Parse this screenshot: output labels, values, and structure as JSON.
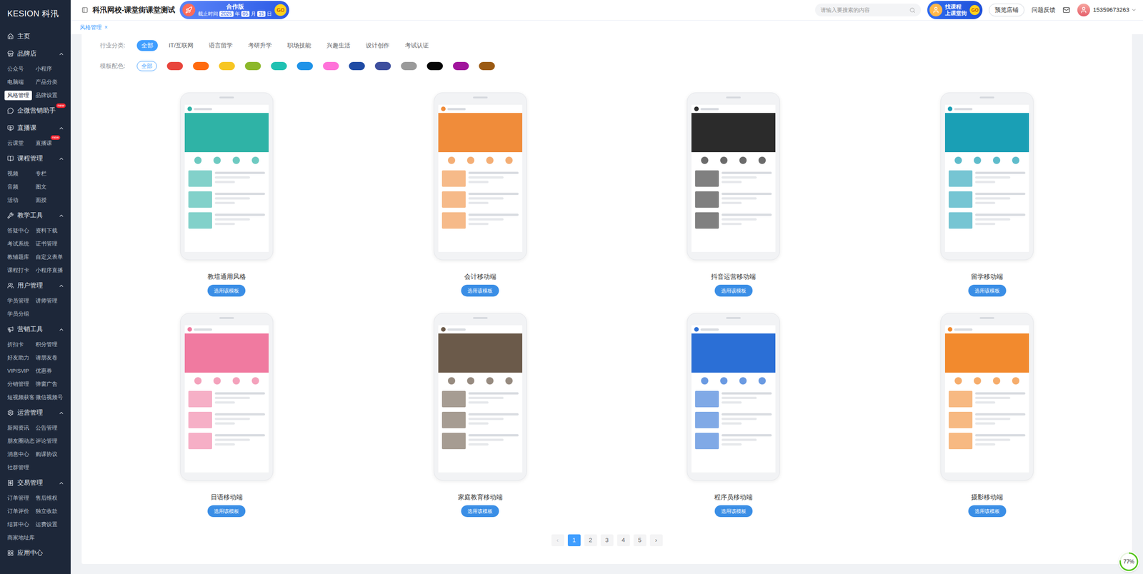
{
  "sidebar": {
    "logo": "KESION 科汛",
    "groups": [
      {
        "label": "主页",
        "kind": "link",
        "items": []
      },
      {
        "label": "品牌店",
        "kind": "group",
        "expanded": true,
        "items": [
          {
            "label": "公众号",
            "selected": false
          },
          {
            "label": "小程序",
            "selected": false
          },
          {
            "label": "电脑端",
            "selected": false
          },
          {
            "label": "产品分类",
            "selected": false
          },
          {
            "label": "风格管理",
            "selected": true
          },
          {
            "label": "品牌设置",
            "selected": false
          }
        ]
      },
      {
        "label": "企微营销助手",
        "kind": "link",
        "badge": "new",
        "items": []
      },
      {
        "label": "直播课",
        "kind": "group",
        "expanded": true,
        "items": [
          {
            "label": "云课堂",
            "selected": false
          },
          {
            "label": "直播课",
            "selected": false,
            "badge": "new"
          }
        ]
      },
      {
        "label": "课程管理",
        "kind": "group",
        "expanded": true,
        "items": [
          {
            "label": "视频",
            "selected": false
          },
          {
            "label": "专栏",
            "selected": false
          },
          {
            "label": "音频",
            "selected": false
          },
          {
            "label": "图文",
            "selected": false
          },
          {
            "label": "活动",
            "selected": false
          },
          {
            "label": "面授",
            "selected": false
          }
        ]
      },
      {
        "label": "教学工具",
        "kind": "group",
        "expanded": true,
        "items": [
          {
            "label": "答疑中心",
            "selected": false
          },
          {
            "label": "资料下载",
            "selected": false
          },
          {
            "label": "考试系统",
            "selected": false
          },
          {
            "label": "证书管理",
            "selected": false
          },
          {
            "label": "教辅题库",
            "selected": false
          },
          {
            "label": "自定义表单",
            "selected": false
          },
          {
            "label": "课程打卡",
            "selected": false
          },
          {
            "label": "小程序直播",
            "selected": false
          }
        ]
      },
      {
        "label": "用户管理",
        "kind": "group",
        "expanded": true,
        "items": [
          {
            "label": "学员管理",
            "selected": false
          },
          {
            "label": "讲师管理",
            "selected": false
          },
          {
            "label": "学员分组",
            "selected": false
          }
        ]
      },
      {
        "label": "营销工具",
        "kind": "group",
        "expanded": true,
        "items": [
          {
            "label": "折扣卡",
            "selected": false
          },
          {
            "label": "积分管理",
            "selected": false
          },
          {
            "label": "好友助力",
            "selected": false
          },
          {
            "label": "请朋友卷",
            "selected": false
          },
          {
            "label": "VIP/SVIP",
            "selected": false
          },
          {
            "label": "优惠券",
            "selected": false
          },
          {
            "label": "分销管理",
            "selected": false
          },
          {
            "label": "弹窗广告",
            "selected": false
          },
          {
            "label": "短视频获客",
            "selected": false
          },
          {
            "label": "微信视频号",
            "selected": false
          }
        ]
      },
      {
        "label": "运营管理",
        "kind": "group",
        "expanded": true,
        "items": [
          {
            "label": "新闻资讯",
            "selected": false
          },
          {
            "label": "公告管理",
            "selected": false
          },
          {
            "label": "朋友圈动态",
            "selected": false
          },
          {
            "label": "评论管理",
            "selected": false
          },
          {
            "label": "消息中心",
            "selected": false
          },
          {
            "label": "购课协议",
            "selected": false
          },
          {
            "label": "社群管理",
            "selected": false
          }
        ]
      },
      {
        "label": "交易管理",
        "kind": "group",
        "expanded": true,
        "items": [
          {
            "label": "订单管理",
            "selected": false
          },
          {
            "label": "售后维权",
            "selected": false
          },
          {
            "label": "订单评价",
            "selected": false
          },
          {
            "label": "独立收款",
            "selected": false
          },
          {
            "label": "结算中心",
            "selected": false
          },
          {
            "label": "运费设置",
            "selected": false
          },
          {
            "label": "商家地址库",
            "selected": false
          }
        ]
      }
    ],
    "footer": "应用中心"
  },
  "header": {
    "title": "科汛网校-课堂街课堂测试",
    "edition_banner": {
      "title": "合作版",
      "deadline": [
        {
          "text": "截止时间",
          "kind": "label"
        },
        {
          "text": "2025",
          "kind": "value"
        },
        {
          "text": "年",
          "kind": "label"
        },
        {
          "text": "05",
          "kind": "value"
        },
        {
          "text": "月",
          "kind": "label"
        },
        {
          "text": "15",
          "kind": "value"
        },
        {
          "text": "日",
          "kind": "label"
        }
      ],
      "go": "GO"
    },
    "search": {
      "placeholder": "请输入要搜索的内容"
    },
    "promo": {
      "lines": [
        "找课程",
        "上课堂街"
      ],
      "go": "GO"
    },
    "preview_button": "预览店铺",
    "feedback": "问题反馈",
    "user": "15359673263"
  },
  "tabs": [
    {
      "label": "风格管理",
      "selected": true,
      "close": "×"
    }
  ],
  "filters": {
    "industry": {
      "label": "行业分类:",
      "options": [
        {
          "label": "全部",
          "selected": true
        },
        {
          "label": "IT/互联网",
          "selected": false
        },
        {
          "label": "语言留学",
          "selected": false
        },
        {
          "label": "考研升学",
          "selected": false
        },
        {
          "label": "职场技能",
          "selected": false
        },
        {
          "label": "兴趣生活",
          "selected": false
        },
        {
          "label": "设计创作",
          "selected": false
        },
        {
          "label": "考试认证",
          "selected": false
        }
      ]
    },
    "palette": {
      "label": "模板配色:",
      "all": {
        "label": "全部",
        "selected": true
      },
      "colors": [
        {
          "color": "#e8453c",
          "selected": false
        },
        {
          "color": "#ff6a0e",
          "selected": false
        },
        {
          "color": "#f7c623",
          "selected": false
        },
        {
          "color": "#8cb82b",
          "selected": false
        },
        {
          "color": "#1fc1b2",
          "selected": false
        },
        {
          "color": "#1f93e8",
          "selected": false
        },
        {
          "color": "#ff72d9",
          "selected": false
        },
        {
          "color": "#1f4ba5",
          "selected": false
        },
        {
          "color": "#3e4f9e",
          "selected": false
        },
        {
          "color": "#9a9a9a",
          "selected": false
        },
        {
          "color": "#050505",
          "selected": false
        },
        {
          "color": "#a0149c",
          "selected": false
        },
        {
          "color": "#9b5a13",
          "selected": false
        }
      ]
    }
  },
  "templates": [
    {
      "name": "教培通用风格",
      "action": "选用该模板",
      "color": "#2fb3a6"
    },
    {
      "name": "会计移动端",
      "action": "选用该模板",
      "color": "#f08c3a"
    },
    {
      "name": "抖音运营移动端",
      "action": "选用该模板",
      "color": "#2b2b2b"
    },
    {
      "name": "留学移动端",
      "action": "选用该模板",
      "color": "#1a9fb5"
    },
    {
      "name": "日语移动端",
      "action": "选用该模板",
      "color": "#f07aa0"
    },
    {
      "name": "家庭教育移动端",
      "action": "选用该模板",
      "color": "#6b5a4a"
    },
    {
      "name": "程序员移动端",
      "action": "选用该模板",
      "color": "#2b6fd6"
    },
    {
      "name": "摄影移动端",
      "action": "选用该模板",
      "color": "#f28a2e"
    }
  ],
  "pagination": {
    "prev": {
      "label": "‹",
      "disabled": true
    },
    "pages": [
      {
        "label": "1",
        "selected": true
      },
      {
        "label": "2",
        "selected": false
      },
      {
        "label": "3",
        "selected": false
      },
      {
        "label": "4",
        "selected": false
      },
      {
        "label": "5",
        "selected": false
      }
    ],
    "next": {
      "label": "›",
      "disabled": false
    }
  },
  "progress_badge": {
    "text": "77%",
    "level": 0.77
  }
}
